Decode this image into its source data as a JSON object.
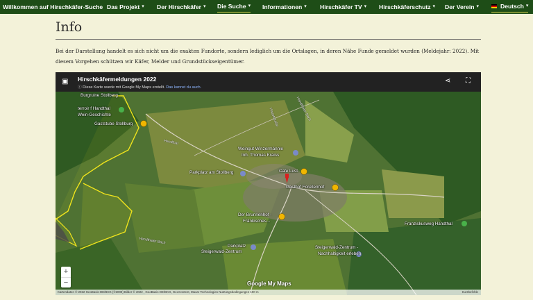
{
  "nav": {
    "brand": "Willkommen auf Hirschkäfer-Suche",
    "items": [
      {
        "label": "Das Projekt",
        "chevron": "chevron-down-icon"
      },
      {
        "label": "Der Hirschkäfer",
        "chevron": "chevron-down-icon"
      },
      {
        "label": "Die Suche",
        "chevron": "chevron-down-icon",
        "active": true
      },
      {
        "label": "Informationen",
        "chevron": "chevron-down-icon"
      },
      {
        "label": "Hirschkäfer TV",
        "chevron": "chevron-down-icon"
      },
      {
        "label": "Hirschkäferschutz",
        "chevron": "chevron-down-icon"
      },
      {
        "label": "Der Verein",
        "chevron": "chevron-down-icon"
      }
    ],
    "language": "Deutsch",
    "colors": {
      "bar": "#1e4d17",
      "active_underline": "#d7d24e"
    }
  },
  "page": {
    "title": "Info",
    "paragraph": "Bei der Darstellung handelt es sich nicht um die exakten Fundorte, sondern lediglich um die Ortslagen, in deren Nähe Funde gemeldet wurden (Meldejahr: 2022). Mit diesem Vorgehen schützen wir Käfer, Melder und Grundstückseigentümer."
  },
  "map": {
    "title": "Hirschkäfermeldungen 2022",
    "subtitle": "Diese Karte wurde mit Google My Maps erstellt.",
    "subtitle_link": "Das kannst du auch.",
    "labels": {
      "burgruine": "Burgruine Stollberg",
      "terroir": "terroir f Handthal",
      "wein": "Wein-Geschichte",
      "gaststube": "Gaststube Stollburg",
      "weingut1": "Weingut Winzermännle",
      "weingut2": "Inh. Thomas Kraiss",
      "parkplatz_stollberg": "Parkplatz am Stollberg",
      "cafe": "Cafe Lust",
      "gasthof": "Gasthof Forellenhof",
      "brunnenhof1": "Der Brunnenhof -",
      "brunnenhof2": "Fränkisches...",
      "franziskusweg": "Franziskusweg Handthal",
      "parkplatz1": "Parkplatz",
      "parkplatz2": "Steigerwald-Zentrum",
      "zentrum1": "Steigerwald-Zentrum -",
      "zentrum2": "Nachhaltigkeit erleben"
    },
    "roads": {
      "handthal": "Handthal",
      "handthaler_bach": "Handthaler Bach",
      "handthaler_bach2": "Handthaler Bach",
      "hauptstr": "Hauptstraße"
    },
    "zoom_in": "+",
    "zoom_out": "−",
    "google_logo": "Google My Maps",
    "footer": "Kartendaten © 2022 GeoBasis-DE/BKG (©2009) Bilder © 2022 , GeoBasis-DE/BKG, GeoContent, Maxar Technologies   Nutzungsbedingungen   100 m",
    "footer_right": "Kurzbefehle",
    "colors": {
      "header": "#222222",
      "polygon": "#f0e41c",
      "marker": "#f1b600",
      "pin": "#d91f1f"
    }
  }
}
